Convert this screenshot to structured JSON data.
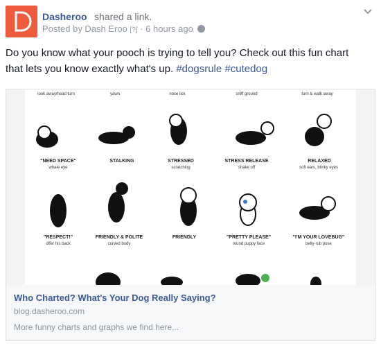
{
  "header": {
    "page_name": "Dasheroo",
    "shared_text": "shared a link.",
    "posted_by": "Posted by Dash Eroo",
    "help": "[?]",
    "time": "· 6 hours ago",
    "avatar_icon": "dasheroo-logo",
    "privacy_icon": "globe-icon",
    "menu_icon": "chevron-down-icon",
    "brand_color": "#ef5b3d"
  },
  "post": {
    "text": "Do you know what your pooch is trying to tell you? Check out this fun chart that lets you know exactly what's up. ",
    "hashtag1": "#dogsrule",
    "hashtag2": "#cutedog"
  },
  "chart_image": {
    "top_row": [
      "look away/head turn",
      "yawn",
      "nose lick",
      "sniff ground",
      "turn & walk away"
    ],
    "row1": [
      {
        "title": "\"NEED SPACE\"",
        "sub": "whale eye"
      },
      {
        "title": "STALKING",
        "sub": ""
      },
      {
        "title": "STRESSED",
        "sub": "scratching"
      },
      {
        "title": "STRESS RELEASE",
        "sub": "shake off"
      },
      {
        "title": "RELAXED",
        "sub": "soft ears, blinky eyes"
      }
    ],
    "row2": [
      {
        "title": "\"RESPECT!\"",
        "sub": "offer his back"
      },
      {
        "title": "FRIENDLY & POLITE",
        "sub": "curved body"
      },
      {
        "title": "FRIENDLY",
        "sub": ""
      },
      {
        "title": "\"PRETTY PLEASE\"",
        "sub": "round puppy face"
      },
      {
        "title": "\"I'M YOUR LOVEBUG\"",
        "sub": "belly-rub pose"
      }
    ]
  },
  "card": {
    "title": "Who Charted? What's Your Dog Really Saying?",
    "domain": "blog.dasheroo.com",
    "description": "More funny charts and graphs we find here..."
  }
}
